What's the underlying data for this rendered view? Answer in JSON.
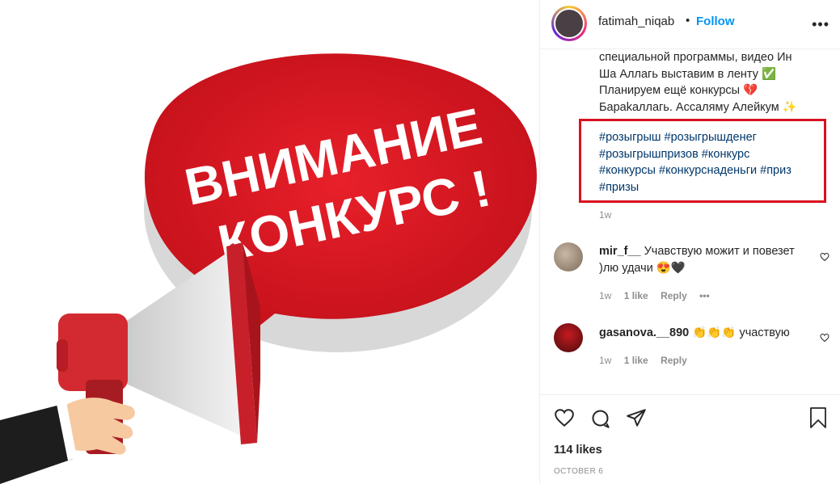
{
  "post": {
    "image_text": {
      "line1": "ВНИМАНИЕ",
      "line2": "КОНКУРС !"
    },
    "header": {
      "username": "fatimah_niqab",
      "separator": "•",
      "follow": "Follow"
    },
    "caption_lines": [
      "специальной программы, видео Ин",
      "Ша Аллагь выставим в ленту ✅",
      "Планируем ещё конкурсы 💔",
      "Бараkаллагь. Ассаляму Алейкум ✨"
    ],
    "hashtag_lines": [
      "#розыгрыш #розыгрышденег",
      "#розыгрышпризов #конкурс",
      "#конкурсы #конкурснаденьги #приз",
      "#призы"
    ],
    "caption_time": "1w",
    "likes": "114 likes",
    "date": "OCTOBER 6"
  },
  "comments": [
    {
      "user": "mir_f__",
      "text": "Учавствую можит и повезет )лю удачи 😍🖤",
      "time": "1w",
      "likes": "1 like",
      "reply": "Reply",
      "more": "•••"
    },
    {
      "user": "gasanova.__890",
      "text": "👏👏👏 участвую",
      "time": "1w",
      "likes": "1 like",
      "reply": "Reply"
    }
  ],
  "colors": {
    "accent_red": "#d9111f",
    "link_blue": "#0095f6",
    "hashtag": "#00376b"
  },
  "icons": [
    "more-icon",
    "heart-icon",
    "comment-icon",
    "share-icon",
    "bookmark-icon"
  ]
}
